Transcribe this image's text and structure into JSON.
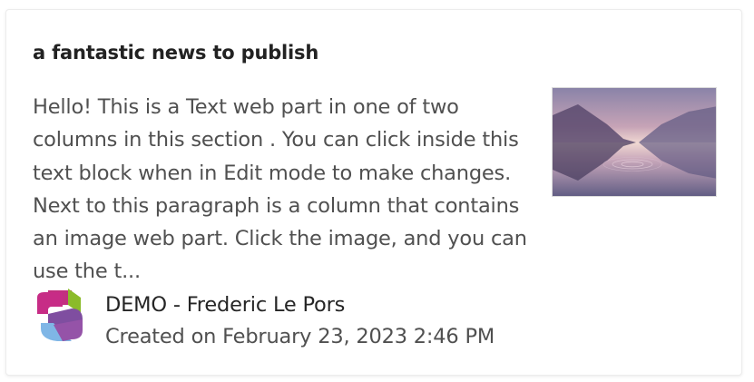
{
  "news_card": {
    "title": "a fantastic news to publish",
    "description": "Hello! This is a Text web part in one of two columns in this section . You can click inside this text block when in Edit mode to make changes. Next to this paragraph is a column that contains an image web part. Click the image, and you can use the t...",
    "thumbnail_icon": "lake-landscape-image",
    "author_logo_icon": "site-logo-icon",
    "author": "DEMO - Frederic Le Pors",
    "created": "Created on February 23, 2023 2:46 PM"
  },
  "colors": {
    "title": "#222222",
    "body_text": "#505050",
    "card_border": "#ececec"
  }
}
